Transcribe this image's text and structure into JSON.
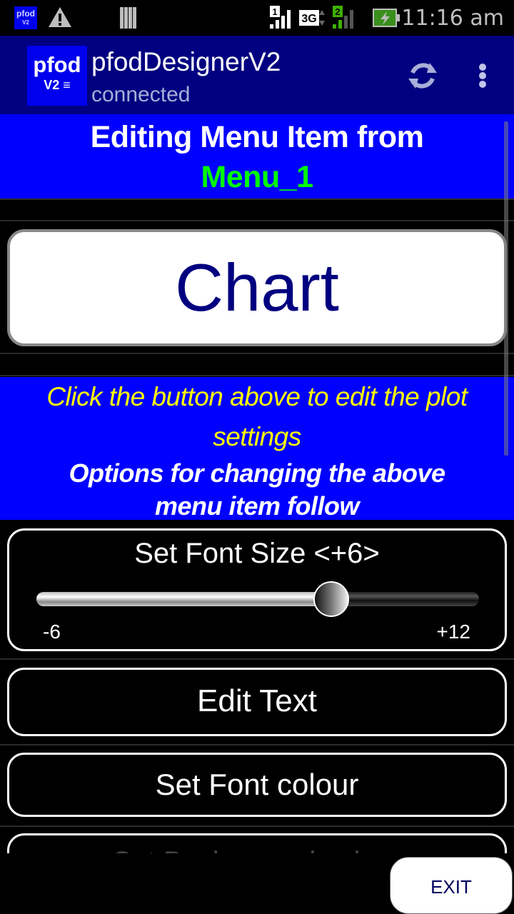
{
  "status_bar": {
    "notification_icons": [
      "pfod-app-icon",
      "warning-icon",
      "storage-icon"
    ],
    "app_icon_text": "pfod",
    "app_icon_sub": "V2",
    "sim1_label": "1",
    "network_type": "3G",
    "sim2_label": "2",
    "battery_state": "charging",
    "time": "11:16 am"
  },
  "action_bar": {
    "logo_line1": "pfod",
    "logo_line2": "V2",
    "title": "pfodDesignerV2",
    "subtitle": "connected",
    "refresh_icon": "refresh-icon",
    "overflow_icon": "more-vert-icon"
  },
  "header": {
    "line1": "Editing Menu Item from",
    "line2": "Menu_1",
    "line2_color": "#00ff00"
  },
  "preview_button": {
    "label": "Chart"
  },
  "info": {
    "instruction": "Click the button above to edit the plot settings",
    "options_note": "Options for changing the above menu item follow"
  },
  "font_size_slider": {
    "label": "Set Font Size <+6>",
    "min_label": "-6",
    "max_label": "+12",
    "min": -6,
    "max": 12,
    "value": 6
  },
  "menu_buttons": [
    {
      "label": "Edit Text"
    },
    {
      "label": "Set Font colour"
    },
    {
      "label": "Set Background colour"
    }
  ],
  "exit_button": {
    "label": "EXIT"
  },
  "colors": {
    "action_bar_bg": "#000080",
    "banner_bg": "#0000ff",
    "instruction_text": "#ffff00",
    "preview_text": "#000080"
  }
}
